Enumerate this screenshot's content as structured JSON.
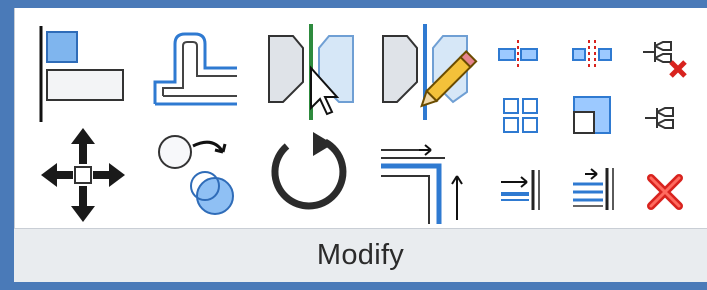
{
  "panel": {
    "title": "Modify"
  },
  "tools": [
    {
      "name": "align",
      "icon": "align-icon"
    },
    {
      "name": "offset",
      "icon": "offset-icon"
    },
    {
      "name": "mirror-pick-axis",
      "icon": "mirror-pick-axis-icon"
    },
    {
      "name": "mirror-draw-axis",
      "icon": "mirror-draw-axis-icon"
    },
    {
      "name": "split-element",
      "icon": "split-element-icon"
    },
    {
      "name": "split-with-gap",
      "icon": "split-with-gap-icon"
    },
    {
      "name": "unpin",
      "icon": "unpin-icon"
    },
    {
      "name": "move",
      "icon": "move-icon"
    },
    {
      "name": "copy",
      "icon": "copy-icon"
    },
    {
      "name": "rotate",
      "icon": "rotate-icon"
    },
    {
      "name": "trim-extend-to-corner",
      "icon": "trim-extend-corner-icon"
    },
    {
      "name": "array",
      "icon": "array-icon"
    },
    {
      "name": "scale",
      "icon": "scale-icon"
    },
    {
      "name": "pin",
      "icon": "pin-icon"
    },
    {
      "name": "trim-extend-single",
      "icon": "trim-extend-single-icon"
    },
    {
      "name": "trim-extend-multiple",
      "icon": "trim-extend-multiple-icon"
    },
    {
      "name": "delete",
      "icon": "delete-icon"
    }
  ],
  "colors": {
    "ribbon_blue": "#4a7ab8",
    "icon_blue": "#2f7ad1",
    "icon_dark": "#1f1f1f",
    "delete_red": "#d8231e",
    "footer_bg": "#e9ecef"
  }
}
